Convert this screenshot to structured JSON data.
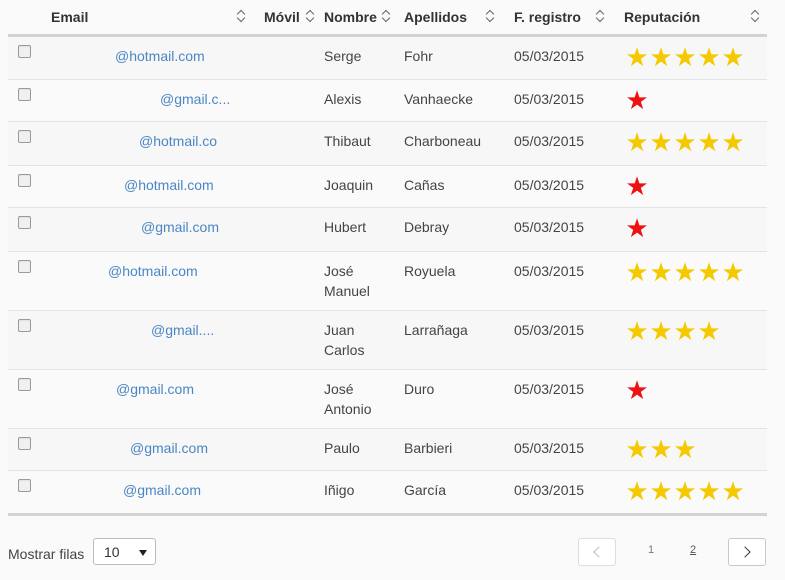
{
  "header": {
    "email": "Email",
    "movil": "Móvil",
    "nombre": "Nombre",
    "apellidos": "Apellidos",
    "fregistro": "F. registro",
    "reputacion": "Reputación"
  },
  "rows": [
    {
      "email": "@hotmail.com",
      "nombre": "Serge",
      "apellidos": "Fohr",
      "fecha": "05/03/2015",
      "rating": 5
    },
    {
      "email": "@gmail.c...",
      "nombre": "Alexis",
      "apellidos": "Vanhaecke",
      "fecha": "05/03/2015",
      "rating": 1
    },
    {
      "email": "@hotmail.co",
      "nombre": "Thibaut",
      "apellidos": "Charboneau",
      "fecha": "05/03/2015",
      "rating": 5
    },
    {
      "email": "@hotmail.com",
      "nombre": "Joaquin",
      "apellidos": "Cañas",
      "fecha": "05/03/2015",
      "rating": 1
    },
    {
      "email": "@gmail.com",
      "nombre": "Hubert",
      "apellidos": "Debray",
      "fecha": "05/03/2015",
      "rating": 1
    },
    {
      "email": "@hotmail.com",
      "nombre": "José Manuel",
      "apellidos": "Royuela",
      "fecha": "05/03/2015",
      "rating": 5
    },
    {
      "email": "@gmail....",
      "nombre": "Juan Carlos",
      "apellidos": "Larrañaga",
      "fecha": "05/03/2015",
      "rating": 4
    },
    {
      "email": "@gmail.com",
      "nombre": "José Antonio",
      "apellidos": "Duro",
      "fecha": "05/03/2015",
      "rating": 1
    },
    {
      "email": "@gmail.com",
      "nombre": "Paulo",
      "apellidos": "Barbieri",
      "fecha": "05/03/2015",
      "rating": 3
    },
    {
      "email": "@gmail.com",
      "nombre": "Iñigo",
      "apellidos": "García",
      "fecha": "05/03/2015",
      "rating": 5
    }
  ],
  "colors": {
    "star_gold": "#f5c900",
    "star_red": "#ee1111",
    "email_link": "#4a86c4"
  },
  "footer": {
    "rows_label": "Mostrar filas",
    "rows_value": "10",
    "page1": "1",
    "page2": "2"
  }
}
